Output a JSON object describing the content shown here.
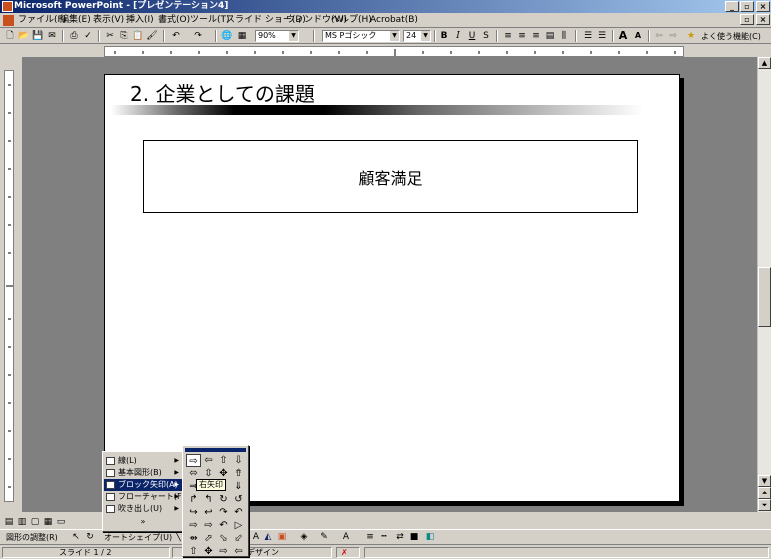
{
  "window": {
    "title": "Microsoft PowerPoint - [プレゼンテーション4]",
    "min_label": "_",
    "max_label": "▫",
    "close_label": "×"
  },
  "menubar": {
    "items": [
      "ファイル(F)",
      "編集(E)",
      "表示(V)",
      "挿入(I)",
      "書式(O)",
      "ツール(T)",
      "スライド ショー(D)",
      "ウィンドウ(W)",
      "ヘルプ(H)",
      "Acrobat(B)"
    ]
  },
  "toolbar": {
    "zoom": "90%",
    "font_name": "MS Pゴシック",
    "font_size": "24",
    "bold": "B",
    "italic": "I",
    "underline": "U",
    "shadow": "S",
    "grow_font": "A",
    "shrink_font": "A",
    "frequent_functions": "よく使う機能(C)"
  },
  "slide": {
    "title": "2. 企業としての課題",
    "textbox": "顧客満足"
  },
  "autoshape_menu": {
    "items": [
      {
        "label": "線(L)",
        "has_sub": true
      },
      {
        "label": "基本図形(B)",
        "has_sub": true
      },
      {
        "label": "ブロック矢印(A)",
        "has_sub": true,
        "active": true
      },
      {
        "label": "フローチャート(F)",
        "has_sub": true
      },
      {
        "label": "吹き出し(U)",
        "has_sub": true
      }
    ],
    "more": "»"
  },
  "arrow_palette": {
    "tooltip": "右矢印",
    "shapes": [
      "⇨",
      "⇦",
      "⇧",
      "⇩",
      "⬄",
      "⇳",
      "✥",
      "⇮",
      "⇒",
      "⇐",
      "⇑",
      "⇓",
      "↱",
      "↰",
      "↻",
      "↺",
      "↪",
      "↩",
      "↷",
      "↶",
      "⇨",
      "⇨",
      "↶",
      "▷",
      "⇴",
      "⬀",
      "⬂",
      "⬃",
      "⇧",
      "✥",
      "⇨",
      "⇦"
    ]
  },
  "drawbar": {
    "draw_label": "図形の調整(R)",
    "autoshape_label": "オートシェイプ(U)"
  },
  "statusbar": {
    "slide_info": "スライド 1 / 2",
    "design": "デザイン"
  }
}
